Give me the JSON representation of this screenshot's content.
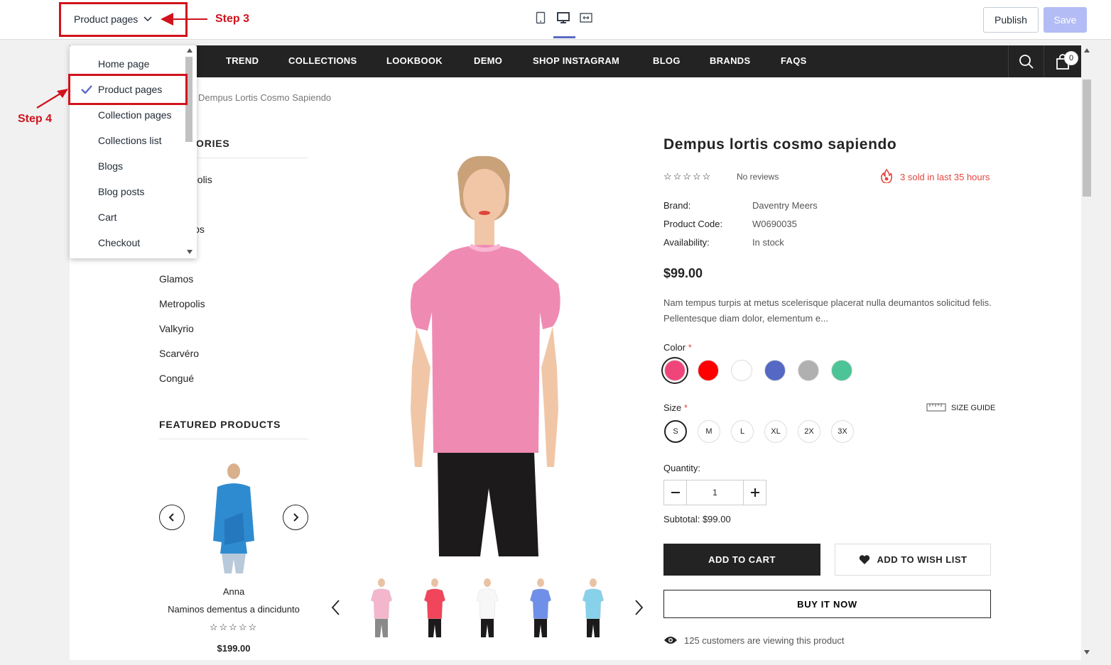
{
  "topbar": {
    "page_select_value": "Product pages",
    "publish_label": "Publish",
    "save_label": "Save"
  },
  "annotations": {
    "step3": "Step 3",
    "step4": "Step 4"
  },
  "dropdown": {
    "items": [
      "Home page",
      "Product pages",
      "Collection pages",
      "Collections list",
      "Blogs",
      "Blog posts",
      "Cart",
      "Checkout"
    ],
    "selected": "Product pages"
  },
  "nav": {
    "items": [
      "TREND",
      "COLLECTIONS",
      "LOOKBOOK",
      "DEMO",
      "SHOP INSTAGRAM",
      "BLOG",
      "BRANDS",
      "FAQS"
    ],
    "cart_count": "0"
  },
  "breadcrumb": "Dempus Lortis Cosmo Sapiendo",
  "sidebar": {
    "categories_title_visible": "ORIES",
    "category_fragments": [
      "polis",
      "los"
    ],
    "categories": [
      "Glamos",
      "Metropolis",
      "Valkyrio",
      "Scarvéro",
      "Congué"
    ],
    "featured_title": "FEATURED PRODUCTS",
    "featured_product": {
      "vendor": "Anna",
      "name": "Naminos dementus a dincidunto",
      "stars": "☆☆☆☆☆",
      "price": "$199.00"
    }
  },
  "product": {
    "title": "Dempus lortis cosmo sapiendo",
    "stars": "☆☆☆☆☆",
    "reviews": "No reviews",
    "sold": "3 sold in last 35 hours",
    "brand_label": "Brand:",
    "brand": "Daventry Meers",
    "code_label": "Product Code:",
    "code": "W0690035",
    "availability_label": "Availability:",
    "availability": "In stock",
    "price": "$99.00",
    "description": "Nam tempus turpis at metus scelerisque placerat nulla deumantos solicitud felis. Pellentesque diam dolor, elementum e...",
    "color_label": "Color",
    "colors": [
      "#f0457a",
      "#ff0000",
      "#ffffff",
      "#5468c4",
      "#b0b0b0",
      "#4cc497"
    ],
    "size_label": "Size",
    "size_guide": "SIZE GUIDE",
    "sizes": [
      "S",
      "M",
      "L",
      "XL",
      "2X",
      "3X"
    ],
    "quantity_label": "Quantity:",
    "quantity": "1",
    "subtotal_label": "Subtotal:",
    "subtotal": "$99.00",
    "add_to_cart": "ADD TO CART",
    "add_to_wishlist": "ADD TO WISH LIST",
    "buy_now": "BUY IT NOW",
    "viewing": "125 customers are viewing this product",
    "thumb_colors": [
      "#f4b6cc",
      "#f0455a",
      "#f7f7f7",
      "#6f8fe8",
      "#87d1ea"
    ]
  },
  "required_mark": "*",
  "accent_color": "#d0131c"
}
